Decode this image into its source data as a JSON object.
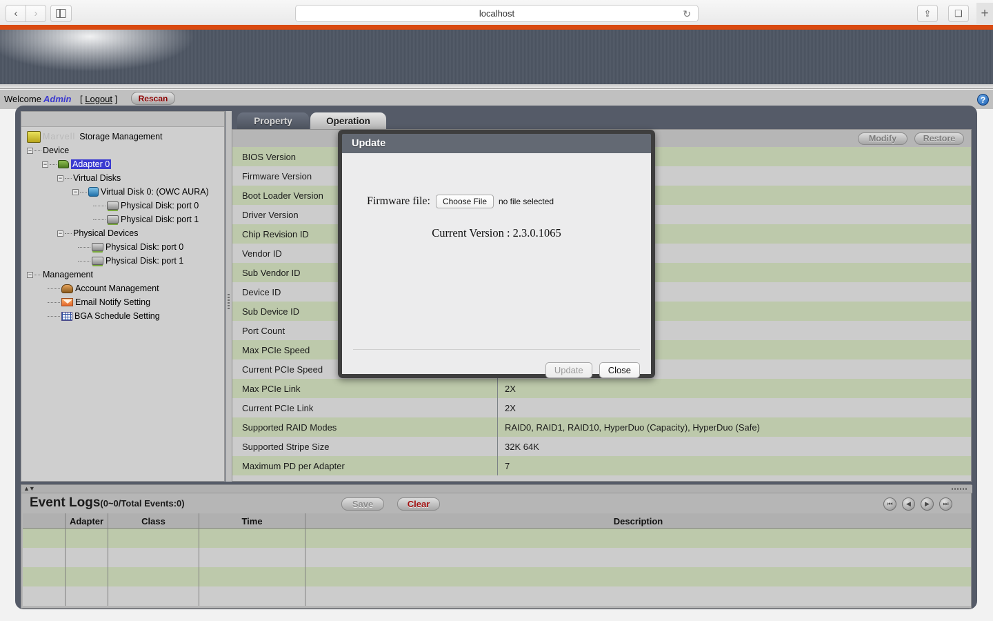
{
  "browser": {
    "back_icon": "chevron-left-icon",
    "forward_icon": "chevron-right-icon",
    "sidebar_icon": "sidebar-toggle-icon",
    "url": "localhost",
    "reload_icon": "↻",
    "share_icon": "⇪",
    "tabs_icon": "❐",
    "new_tab_label": "+"
  },
  "topbar": {
    "welcome_label": "Welcome",
    "user": "Admin",
    "logout_open": "[",
    "logout_label": "Logout",
    "logout_close": "]",
    "rescan_label": "Rescan",
    "help_icon_label": "?"
  },
  "tree": {
    "root_brand_ghost": "Marvell",
    "root_label": "Storage Management",
    "items": [
      {
        "label": "Device",
        "indent": 0,
        "expander": "−",
        "icon": "",
        "selected": false
      },
      {
        "label": "Adapter 0",
        "indent": 22,
        "expander": "−",
        "icon": "adapter-icon",
        "selected": true
      },
      {
        "label": "Virtual Disks",
        "indent": 44,
        "expander": "−",
        "icon": "",
        "selected": false
      },
      {
        "label": "Virtual Disk 0: (OWC AURA)",
        "indent": 66,
        "expander": "−",
        "icon": "virtual-disk-icon",
        "selected": false
      },
      {
        "label": "Physical Disk: port 0",
        "indent": 96,
        "expander": "",
        "icon": "physical-disk-icon",
        "selected": false
      },
      {
        "label": "Physical Disk: port 1",
        "indent": 96,
        "expander": "",
        "icon": "physical-disk-icon",
        "selected": false
      },
      {
        "label": "Physical Devices",
        "indent": 44,
        "expander": "−",
        "icon": "",
        "selected": false
      },
      {
        "label": "Physical Disk: port 0",
        "indent": 74,
        "expander": "",
        "icon": "physical-disk-icon",
        "selected": false
      },
      {
        "label": "Physical Disk: port 1",
        "indent": 74,
        "expander": "",
        "icon": "physical-disk-icon",
        "selected": false
      },
      {
        "label": "Management",
        "indent": 0,
        "expander": "−",
        "icon": "",
        "selected": false
      },
      {
        "label": "Account Management",
        "indent": 30,
        "expander": "",
        "icon": "account-icon",
        "selected": false
      },
      {
        "label": "Email Notify Setting",
        "indent": 30,
        "expander": "",
        "icon": "email-icon",
        "selected": false
      },
      {
        "label": "BGA Schedule Setting",
        "indent": 30,
        "expander": "",
        "icon": "bga-calendar-icon",
        "selected": false
      }
    ]
  },
  "tabs": [
    {
      "label": "Property",
      "active": false
    },
    {
      "label": "Operation",
      "active": true
    }
  ],
  "property_panel": {
    "modify_label": "Modify",
    "restore_label": "Restore",
    "rows": [
      {
        "name": "BIOS Version",
        "value": ""
      },
      {
        "name": "Firmware Version",
        "value": ""
      },
      {
        "name": "Boot Loader Version",
        "value": ""
      },
      {
        "name": "Driver Version",
        "value": ""
      },
      {
        "name": "Chip Revision ID",
        "value": ""
      },
      {
        "name": "Vendor ID",
        "value": ""
      },
      {
        "name": "Sub Vendor ID",
        "value": ""
      },
      {
        "name": "Device ID",
        "value": ""
      },
      {
        "name": "Sub Device ID",
        "value": ""
      },
      {
        "name": "Port Count",
        "value": ""
      },
      {
        "name": "Max PCIe Speed",
        "value": ""
      },
      {
        "name": "Current PCIe Speed",
        "value": ""
      },
      {
        "name": "Max PCIe Link",
        "value": "2X"
      },
      {
        "name": "Current PCIe Link",
        "value": "2X"
      },
      {
        "name": "Supported RAID Modes",
        "value": "RAID0, RAID1, RAID10, HyperDuo (Capacity), HyperDuo (Safe)"
      },
      {
        "name": "Supported Stripe Size",
        "value": "32K 64K"
      },
      {
        "name": "Maximum PD per Adapter",
        "value": "7"
      }
    ]
  },
  "event_logs": {
    "title": "Event Logs",
    "count_text": "(0~0/Total Events:0)",
    "save_label": "Save",
    "clear_label": "Clear",
    "pager": {
      "first_icon": "⏮",
      "prev_icon": "◀",
      "next_icon": "▶",
      "last_icon": "⏭"
    },
    "columns": [
      "",
      "Adapter",
      "Class",
      "Time",
      "Description"
    ],
    "rows": [
      {
        "cells": [
          "",
          "",
          "",
          "",
          ""
        ]
      },
      {
        "cells": [
          "",
          "",
          "",
          "",
          ""
        ]
      },
      {
        "cells": [
          "",
          "",
          "",
          "",
          ""
        ]
      },
      {
        "cells": [
          "",
          "",
          "",
          "",
          ""
        ]
      }
    ]
  },
  "modal": {
    "title": "Update",
    "firmware_label": "Firmware file:",
    "choose_file_label": "Choose File",
    "no_file_text": "no file selected",
    "current_version": "Current Version : 2.3.0.1065",
    "update_label": "Update",
    "close_label": "Close"
  },
  "colors": {
    "accent_orange": "#d94a11",
    "row_green": "#bdc9ab",
    "row_grey": "#cccccc",
    "frame_dark": "#555b68",
    "modal_titlebar": "#636973",
    "link_blue": "#3b39cf",
    "rescan_red": "#8b0000"
  }
}
